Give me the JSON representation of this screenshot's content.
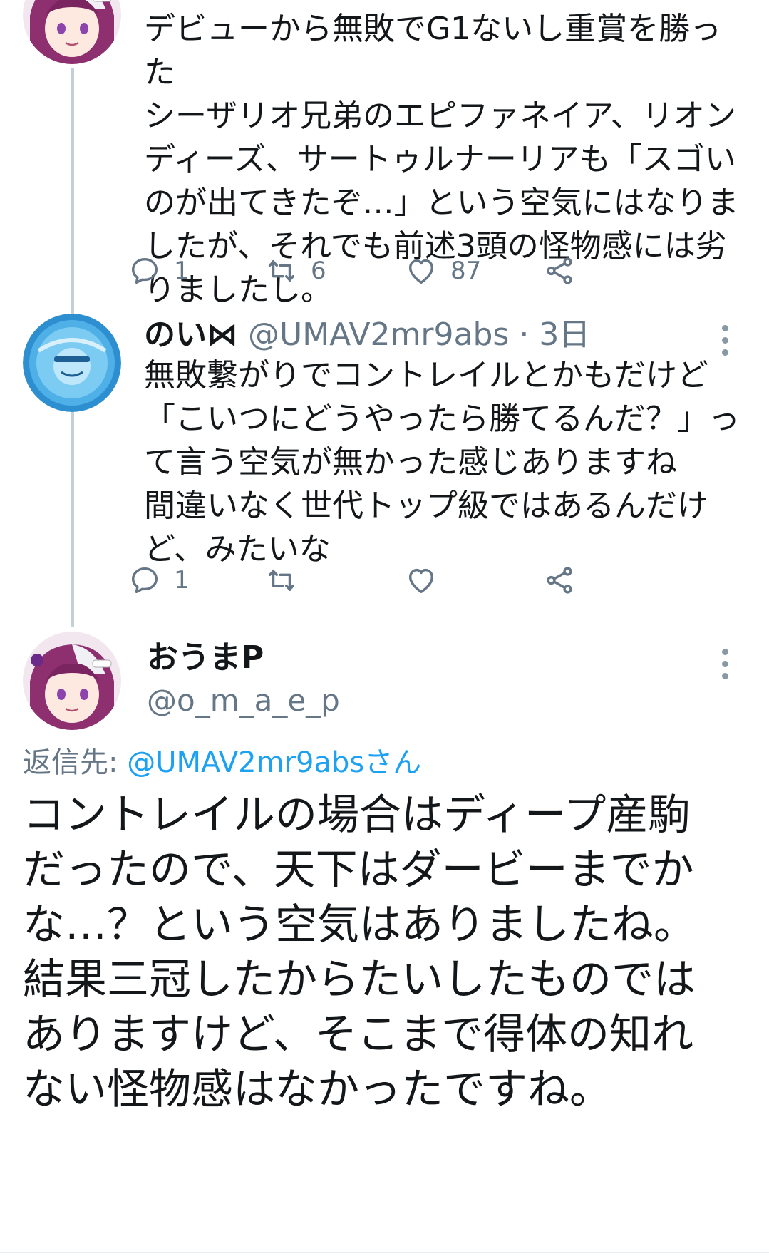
{
  "tweets": [
    {
      "body": "デビューから無敗でG1ないし重賞を勝った\nシーザリオ兄弟のエピファネイア、リオン\nディーズ、サートゥルナーリアも「スゴい\nのが出てきたぞ…」という空気にはなりま\nしたが、それでも前述3頭の怪物感には劣\nりましたし。",
      "stats": {
        "replies": "1",
        "retweets": "6",
        "likes": "87"
      }
    },
    {
      "display_name": "のい⋈",
      "handle": "@UMAV2mr9abs",
      "separator": "·",
      "time": "3日",
      "body": "無敗繋がりでコントレイルとかもだけど\n「こいつにどうやったら勝てるんだ？」っ\nて言う空気が無かった感じありますね\n間違いなく世代トップ級ではあるんだけ\nど、みたいな",
      "stats": {
        "replies": "1",
        "retweets": "",
        "likes": ""
      }
    }
  ],
  "main_tweet": {
    "display_name": "おうまP",
    "handle": "@o_m_a_e_p",
    "reply_label": "返信先:",
    "reply_target": "@UMAV2mr9absさん",
    "body": "コントレイルの場合はディープ産駒\nだったので、天下はダービーまでか\nな…？という空気はありましたね。\n結果三冠したからたいしたものでは\nありますけど、そこまで得体の知れ\nない怪物感はなかったですね。"
  },
  "colors": {
    "accent": "#1da1f2",
    "muted": "#657786",
    "text": "#14171a",
    "thread_line": "#c4cfd6"
  },
  "icons": {
    "reply": "reply-icon",
    "retweet": "retweet-icon",
    "like": "heart-icon",
    "share": "share-icon",
    "more": "more-vertical-icon"
  }
}
